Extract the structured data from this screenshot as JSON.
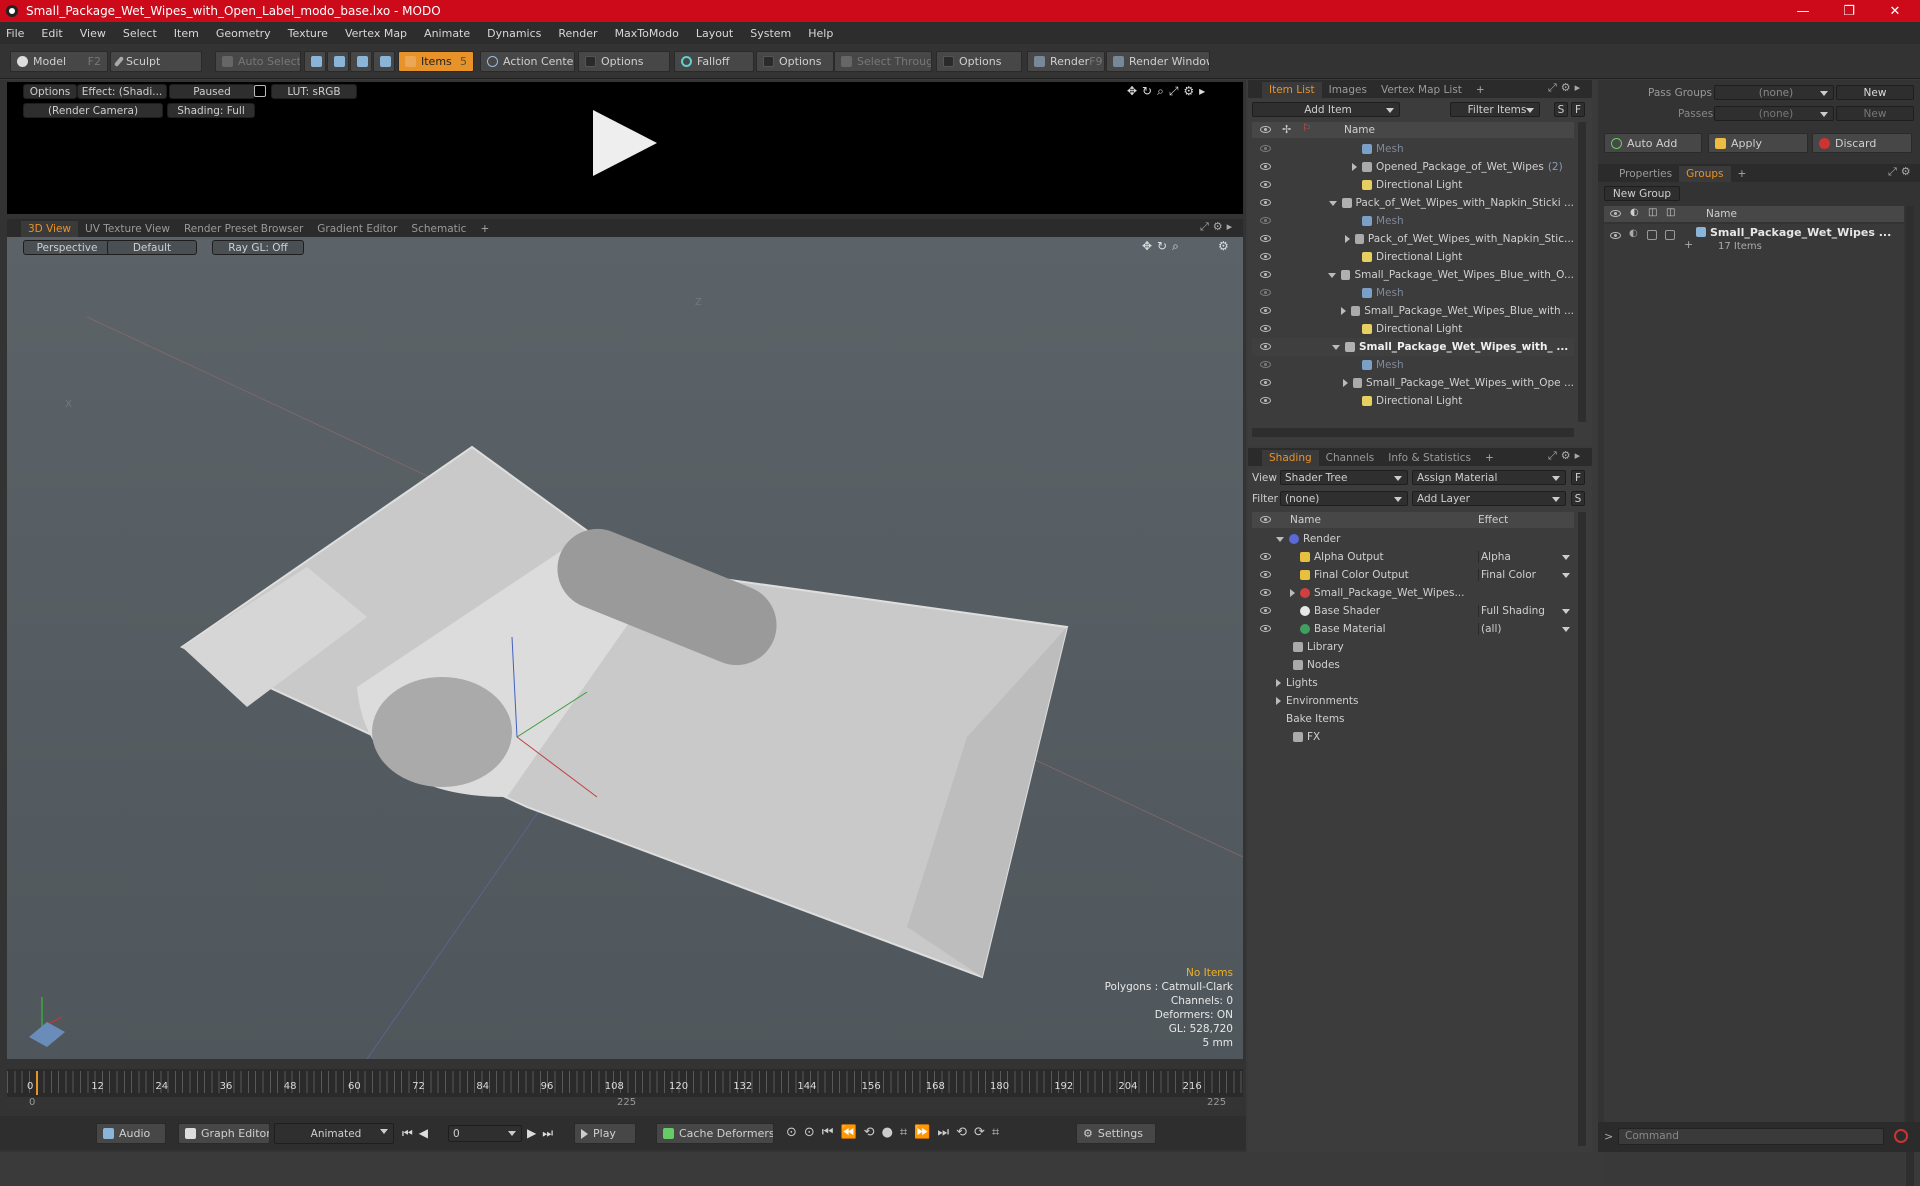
{
  "window": {
    "title": "Small_Package_Wet_Wipes_with_Open_Label_modo_base.lxo - MODO",
    "minimize": "—",
    "maximize": "❐",
    "close": "✕"
  },
  "menu": [
    "File",
    "Edit",
    "View",
    "Select",
    "Item",
    "Geometry",
    "Texture",
    "Vertex Map",
    "Animate",
    "Dynamics",
    "Render",
    "MaxToModo",
    "Layout",
    "System",
    "Help"
  ],
  "toolbar": {
    "model": "Model",
    "model_key": "F2",
    "sculpt": "Sculpt",
    "auto_select": "Auto Select",
    "items": "Items",
    "items_key": "5",
    "action_center": "Action Center",
    "options1": "Options",
    "falloff": "Falloff",
    "options2": "Options",
    "select_through": "Select Through",
    "options3": "Options",
    "render": "Render",
    "render_key": "F9",
    "render_window": "Render Window"
  },
  "preview": {
    "options": "Options",
    "effect": "Effect: (Shadi...",
    "paused": "Paused",
    "lut": "LUT: sRGB",
    "camera": "(Render Camera)",
    "shading": "Shading: Full"
  },
  "viewport_tabs": [
    "3D View",
    "UV Texture View",
    "Render Preset Browser",
    "Gradient Editor",
    "Schematic",
    "+"
  ],
  "viewport": {
    "perspective": "Perspective",
    "default": "Default",
    "raygl": "Ray GL: Off",
    "axis_z": "Z",
    "axis_x": "X",
    "info": {
      "no_items": "No Items",
      "polygons": "Polygons : Catmull-Clark",
      "channels": "Channels: 0",
      "deformers": "Deformers: ON",
      "gl": "GL: 528,720",
      "unit": "5 mm"
    }
  },
  "timeline": {
    "ticks": [
      "0",
      "12",
      "24",
      "36",
      "48",
      "60",
      "72",
      "84",
      "96",
      "108",
      "120",
      "132",
      "144",
      "156",
      "168",
      "180",
      "192",
      "204",
      "216"
    ],
    "range_start": "0",
    "range_mid": "225",
    "range_end": "225"
  },
  "bottombar": {
    "audio": "Audio",
    "graph_editor": "Graph Editor",
    "animated": "Animated",
    "frame": "0",
    "play": "Play",
    "cache_deformers": "Cache Deformers",
    "settings": "Settings"
  },
  "item_list": {
    "tabs": [
      "Item List",
      "Images",
      "Vertex Map List",
      "+"
    ],
    "add_item": "Add Item",
    "filter_items": "Filter Items",
    "s": "S",
    "f": "F",
    "col_name": "Name",
    "rows": [
      {
        "text": "Mesh",
        "indent": 3,
        "kind": "mesh",
        "dim": true,
        "arrow": ""
      },
      {
        "text": "Opened_Package_of_Wet_Wipes",
        "suffix": "(2)",
        "indent": 3,
        "kind": "group",
        "arrow": "right"
      },
      {
        "text": "Directional Light",
        "indent": 3,
        "kind": "light",
        "arrow": ""
      },
      {
        "text": "Pack_of_Wet_Wipes_with_Napkin_Sticki ...",
        "indent": 1,
        "kind": "scene",
        "arrow": "down"
      },
      {
        "text": "Mesh",
        "indent": 3,
        "kind": "mesh",
        "dim": true,
        "arrow": ""
      },
      {
        "text": "Pack_of_Wet_Wipes_with_Napkin_Stic...",
        "indent": 3,
        "kind": "group",
        "arrow": "right"
      },
      {
        "text": "Directional Light",
        "indent": 3,
        "kind": "light",
        "arrow": ""
      },
      {
        "text": "Small_Package_Wet_Wipes_Blue_with_O...",
        "indent": 1,
        "kind": "scene",
        "arrow": "down"
      },
      {
        "text": "Mesh",
        "indent": 3,
        "kind": "mesh",
        "dim": true,
        "arrow": ""
      },
      {
        "text": "Small_Package_Wet_Wipes_Blue_with ...",
        "indent": 3,
        "kind": "group",
        "arrow": "right"
      },
      {
        "text": "Directional Light",
        "indent": 3,
        "kind": "light",
        "arrow": ""
      },
      {
        "text": "Small_Package_Wet_Wipes_with_ ...",
        "indent": 1,
        "kind": "scene",
        "arrow": "down",
        "bold": true
      },
      {
        "text": "Mesh",
        "indent": 3,
        "kind": "mesh",
        "dim": true,
        "arrow": ""
      },
      {
        "text": "Small_Package_Wet_Wipes_with_Ope ...",
        "indent": 3,
        "kind": "group",
        "arrow": "right"
      },
      {
        "text": "Directional Light",
        "indent": 3,
        "kind": "light",
        "arrow": ""
      }
    ]
  },
  "shading": {
    "tabs": [
      "Shading",
      "Channels",
      "Info & Statistics",
      "+"
    ],
    "view_label": "View",
    "view_value": "Shader Tree",
    "assign_material": "Assign Material",
    "f": "F",
    "filter_label": "Filter",
    "filter_value": "(none)",
    "add_layer": "Add Layer",
    "s": "S",
    "col_name": "Name",
    "col_effect": "Effect",
    "rows": [
      {
        "text": "Render",
        "effect": "",
        "indent": 0,
        "kind": "render",
        "arrow": "down",
        "eye": false
      },
      {
        "text": "Alpha Output",
        "effect": "Alpha",
        "indent": 1,
        "kind": "output",
        "eye": true
      },
      {
        "text": "Final Color Output",
        "effect": "Final Color",
        "indent": 1,
        "kind": "output",
        "eye": true
      },
      {
        "text": "Small_Package_Wet_Wipes...",
        "effect": "",
        "indent": 1,
        "kind": "material",
        "arrow": "right",
        "eye": true
      },
      {
        "text": "Base Shader",
        "effect": "Full Shading",
        "indent": 1,
        "kind": "shader",
        "eye": true
      },
      {
        "text": "Base Material",
        "effect": "(all)",
        "indent": 1,
        "kind": "basemat",
        "eye": true
      },
      {
        "text": "Library",
        "effect": "",
        "indent": 0.5,
        "kind": "folder",
        "eye": false
      },
      {
        "text": "Nodes",
        "effect": "",
        "indent": 0.5,
        "kind": "folder",
        "eye": false
      },
      {
        "text": "Lights",
        "effect": "",
        "indent": 0,
        "kind": "none",
        "arrow": "right",
        "eye": false
      },
      {
        "text": "Environments",
        "effect": "",
        "indent": 0,
        "kind": "none",
        "arrow": "right",
        "eye": false
      },
      {
        "text": "Bake Items",
        "effect": "",
        "indent": 0,
        "kind": "none",
        "eye": false
      },
      {
        "text": "FX",
        "effect": "",
        "indent": 0.5,
        "kind": "fx",
        "eye": false
      }
    ]
  },
  "passes": {
    "pass_groups_label": "Pass Groups",
    "pass_groups_value": "(none)",
    "new1": "New",
    "passes_label": "Passes",
    "passes_value": "(none)",
    "new2": "New",
    "auto_add": "Auto Add",
    "apply": "Apply",
    "discard": "Discard"
  },
  "groups": {
    "tabs": [
      "Properties",
      "Groups",
      "+"
    ],
    "new_group": "New Group",
    "col_name": "Name",
    "item": "Small_Package_Wet_Wipes ...",
    "count": "17 Items"
  },
  "command": {
    "placeholder": "Command",
    "prompt": ">"
  }
}
